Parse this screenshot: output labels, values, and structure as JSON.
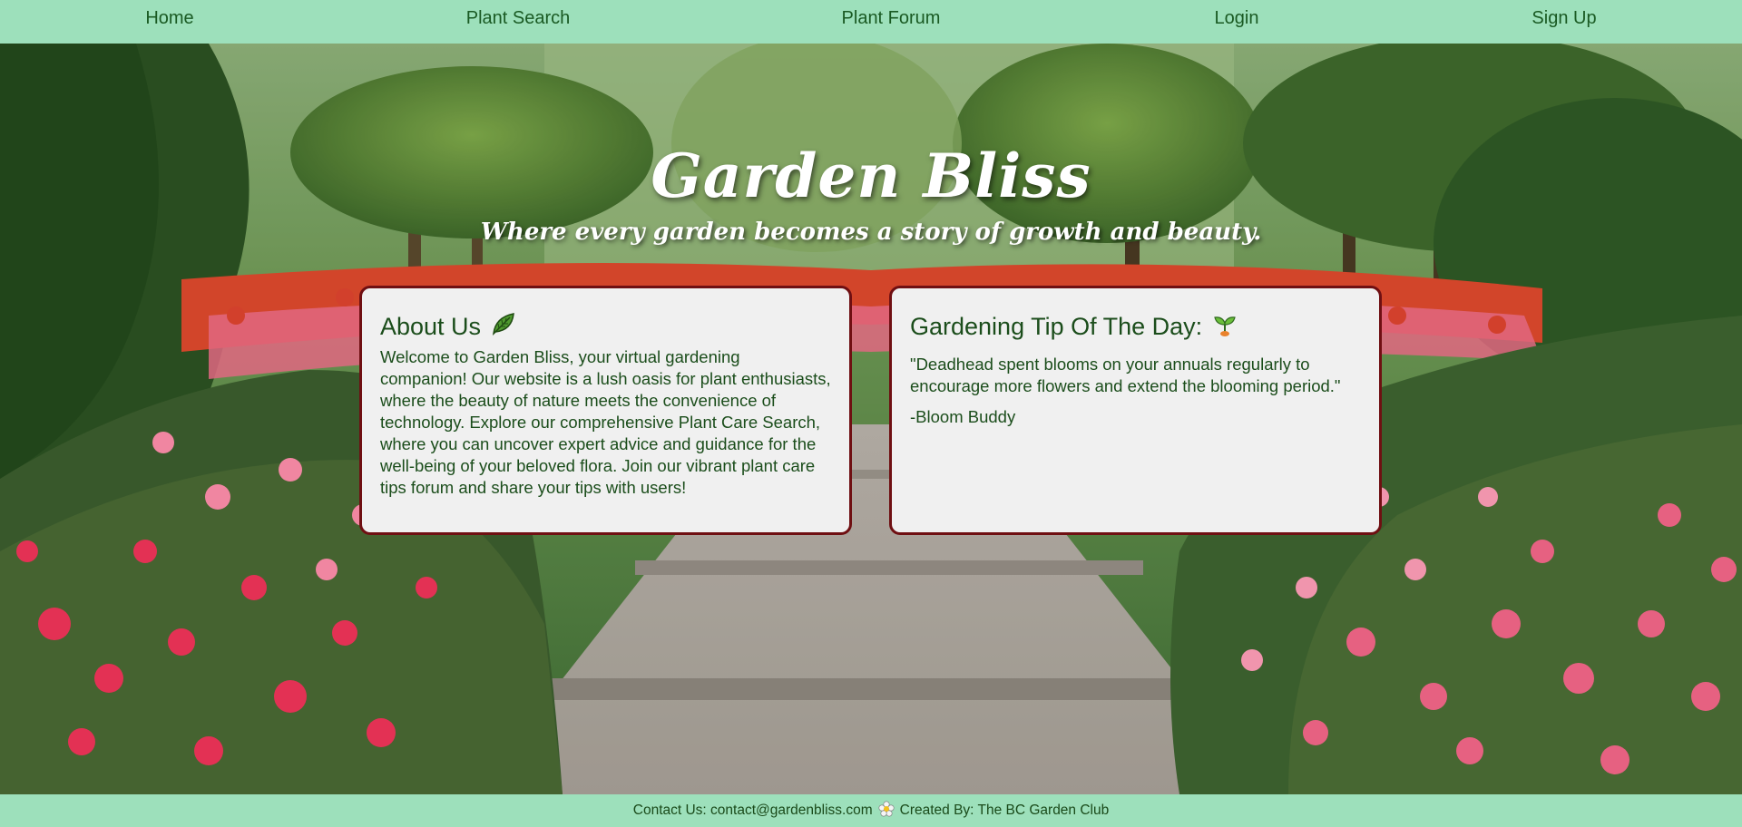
{
  "nav": {
    "home": "Home",
    "plant_search": "Plant Search",
    "plant_forum": "Plant Forum",
    "login": "Login",
    "sign_up": "Sign Up"
  },
  "hero": {
    "title": "Garden Bliss",
    "tagline": "Where every garden becomes a story of growth and beauty."
  },
  "about": {
    "heading": "About Us",
    "icon": "leaf-icon",
    "body": "Welcome to Garden Bliss, your virtual gardening companion! Our website is a lush oasis for plant enthusiasts, where the beauty of nature meets the convenience of technology. Explore our comprehensive Plant Care Search, where you can uncover expert advice and guidance for the well-being of your beloved flora. Join our vibrant plant care tips forum and share your tips with users!"
  },
  "tip": {
    "heading": "Gardening Tip Of The Day:",
    "icon": "seedling-icon",
    "quote": "\"Deadhead spent blooms on your annuals regularly to encourage more flowers and extend the blooming period.\"",
    "author": "-Bloom Buddy"
  },
  "footer": {
    "contact": "Contact Us: contact@gardenbliss.com",
    "icon": "flower-icon",
    "credit": "Created By: The BC Garden Club"
  },
  "colors": {
    "nav_bg": "#9de0bb",
    "footer_bg": "#9de0bb",
    "text_green": "#1b4d1b",
    "card_bg": "#f0f0f0",
    "card_border": "#6f0f12"
  }
}
